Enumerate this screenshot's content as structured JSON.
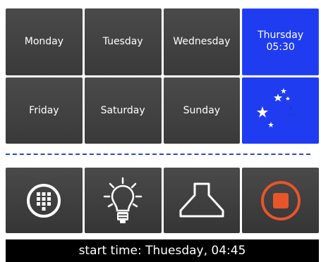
{
  "schedule": {
    "days": [
      {
        "label": "Monday",
        "active": false
      },
      {
        "label": "Tuesday",
        "active": false
      },
      {
        "label": "Wednesday",
        "active": false
      },
      {
        "label": "Thursday",
        "time": "05:30",
        "active": true
      },
      {
        "label": "Friday",
        "active": false
      },
      {
        "label": "Saturday",
        "active": false
      },
      {
        "label": "Sunday",
        "active": false
      }
    ],
    "mode_icon": "moon-stars-icon",
    "accent_color": "#1f3cf0"
  },
  "toolbar": {
    "buttons": [
      {
        "icon": "keypad-icon"
      },
      {
        "icon": "lightbulb-icon"
      },
      {
        "icon": "range-hood-icon"
      },
      {
        "icon": "stop-icon",
        "color": "#e8552a"
      }
    ]
  },
  "status": {
    "text": "start time: Thuesday, 04:45"
  }
}
